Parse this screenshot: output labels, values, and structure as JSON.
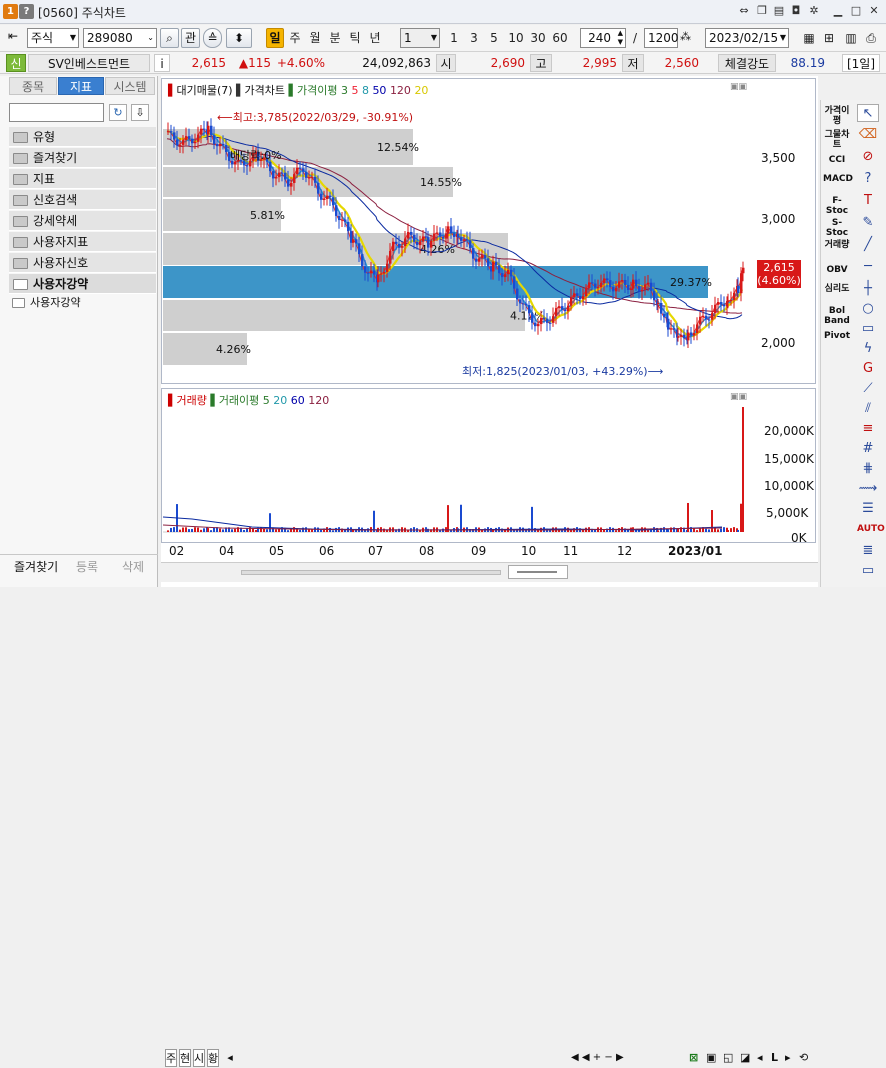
{
  "window": {
    "screen_id": "[0560]",
    "title": "주식차트"
  },
  "toolbar": {
    "market": "주식",
    "code": "289080",
    "btn_search_label": "관",
    "period_tabs": [
      "일",
      "주",
      "월",
      "분",
      "틱",
      "년"
    ],
    "interval_select": "1",
    "period_numbers": [
      "1",
      "3",
      "5",
      "10",
      "30",
      "60"
    ],
    "count_value": "240",
    "total_count": "1200",
    "date_value": "2023/02/15"
  },
  "quote": {
    "badge": "신",
    "name": "SV인베스트먼트",
    "info": "i",
    "price": "2,615",
    "change": "▲115",
    "change_pct": "+4.60%",
    "volume": "24,092,863",
    "open_label": "시",
    "open": "2,690",
    "high_label": "고",
    "high": "2,995",
    "low_label": "저",
    "low": "2,560",
    "strength_label": "체결강도",
    "strength": "88.19",
    "period_badge": "[1일]"
  },
  "left_panel": {
    "tabs": [
      "종목",
      "지표",
      "시스템"
    ],
    "active_tab": 1,
    "items": [
      "유형",
      "즐겨찾기",
      "지표",
      "신호검색",
      "강세약세",
      "사용자지표",
      "사용자신호",
      "사용자강약"
    ],
    "active_item": "사용자강약",
    "child_item": "사용자강약",
    "footer": [
      "즐겨찾기",
      "등록",
      "삭제"
    ]
  },
  "price_pane": {
    "legend": [
      "대기매물(7)",
      "가격차트",
      "가격이평",
      "3",
      "5",
      "8",
      "50",
      "120",
      "20"
    ],
    "legend_colors": [
      "#c00",
      "#333",
      "#2a7a2a",
      "#2a7a2a",
      "#e23",
      "#29a",
      "#00a",
      "#8b2040",
      "#e0d000"
    ],
    "high_note": "최고:3,785(2022/03/29, -30.91%)",
    "low_note": "최저:1,825(2023/01/03, +43.29%)",
    "dividend_note": "배당락:0%",
    "yaxis": [
      "3,500",
      "3,000",
      "2,000"
    ],
    "last_price_tag": "2,615",
    "last_pct_tag": "(4.60%)",
    "supply_pct": [
      "12.54%",
      "14.55%",
      "5.81%",
      "4.26%",
      "29.37%",
      "",
      "4.26%"
    ],
    "supply_inline": [
      "4.26%",
      "4.12%"
    ]
  },
  "volume_pane": {
    "legend": [
      "거래량",
      "거래이평",
      "5",
      "20",
      "60",
      "120"
    ],
    "legend_colors": [
      "#c00",
      "#2a7a2a",
      "#2a7a2a",
      "#29a",
      "#00a",
      "#8b2040"
    ],
    "yaxis": [
      "20,000K",
      "15,000K",
      "10,000K",
      "5,000K",
      "0K"
    ]
  },
  "xaxis": [
    "02",
    "04",
    "05",
    "06",
    "07",
    "08",
    "09",
    "10",
    "11",
    "12",
    "2023/01"
  ],
  "bottom_bar": {
    "tabs": [
      "주",
      "현",
      "시",
      "황"
    ],
    "right_icons": [
      "◀",
      "◀",
      "+",
      "−",
      "▶",
      "L",
      "▶"
    ]
  },
  "right_tools": [
    "가격이평",
    "그물차트",
    "CCI",
    "MACD",
    "F-Stoc",
    "S-Stoc",
    "거래량",
    "OBV",
    "심리도",
    "Bol Band",
    "Pivot"
  ],
  "chart_data": {
    "type": "candlestick",
    "x": [
      "2022-02",
      "2022-04",
      "2022-05",
      "2022-06",
      "2022-07",
      "2022-08",
      "2022-09",
      "2022-10",
      "2022-11",
      "2022-12",
      "2023-01"
    ],
    "close_approx": [
      3600,
      3650,
      3350,
      3250,
      2500,
      2900,
      2950,
      2650,
      2350,
      2400,
      2500,
      2615
    ],
    "ylim": [
      1800,
      3800
    ],
    "volume_ylim_K": [
      0,
      23000
    ]
  }
}
